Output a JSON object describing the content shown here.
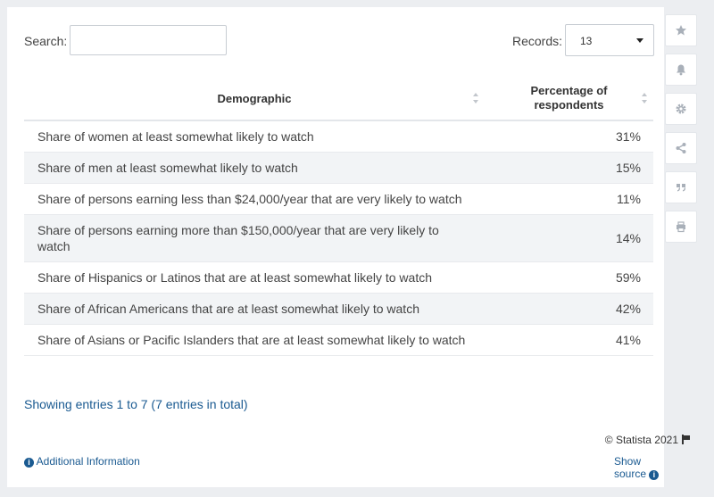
{
  "search": {
    "label": "Search:",
    "value": "",
    "placeholder": ""
  },
  "records": {
    "label": "Records:",
    "value": "13"
  },
  "table": {
    "headers": [
      "Demographic",
      "Percentage of respondents"
    ],
    "rows": [
      {
        "demographic": "Share of women at least somewhat likely to watch",
        "pct": "31%"
      },
      {
        "demographic": "Share of men at least somewhat likely to watch",
        "pct": "15%"
      },
      {
        "demographic": "Share of persons earning less than $24,000/year that are very likely to watch",
        "pct": "11%"
      },
      {
        "demographic": "Share of persons earning more than $150,000/year that are very likely to watch",
        "pct": "14%"
      },
      {
        "demographic": "Share of Hispanics or Latinos that are at least somewhat likely to watch",
        "pct": "59%"
      },
      {
        "demographic": "Share of African Americans that are at least somewhat likely to watch",
        "pct": "42%"
      },
      {
        "demographic": "Share of Asians or Pacific Islanders that are at least somewhat likely to watch",
        "pct": "41%"
      }
    ]
  },
  "footer": {
    "entries": "Showing entries 1 to 7 (7 entries in total)",
    "copyright": "© Statista 2021",
    "additional_info": "Additional Information",
    "show_source": "Show source"
  },
  "sidebar": {
    "icons": [
      "star-icon",
      "bell-icon",
      "gear-icon",
      "share-icon",
      "quote-icon",
      "print-icon"
    ]
  },
  "colors": {
    "link": "#1a5a91",
    "background": "#eceef1",
    "stripe": "#f2f4f6"
  }
}
